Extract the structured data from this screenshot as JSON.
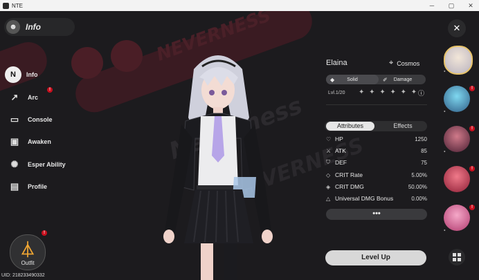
{
  "window": {
    "title": "NTE",
    "min": "─",
    "max": "▢",
    "close": "✕"
  },
  "header": {
    "title": "Info"
  },
  "nav": [
    {
      "label": "Info",
      "icon": "N"
    },
    {
      "label": "Arc",
      "icon": "↗"
    },
    {
      "label": "Console",
      "icon": "▭"
    },
    {
      "label": "Awaken",
      "icon": "▣"
    },
    {
      "label": "Esper Ability",
      "icon": "✺"
    },
    {
      "label": "Profile",
      "icon": "▤"
    }
  ],
  "badge": "!",
  "outfit": {
    "label": "Outfit"
  },
  "uid": "UID: 218233490332",
  "banner_text": [
    "NEVERNESS",
    "Neverness",
    "NEVERNESS"
  ],
  "character": {
    "name": "Elaina",
    "faction": "Cosmos",
    "attributes_tags": [
      "Solid",
      "Damage"
    ],
    "level": "Lvl.1/20",
    "stars": "✦ ✦ ✦ ✦ ✦ ✦"
  },
  "tabs": {
    "attributes": "Attributes",
    "effects": "Effects"
  },
  "stats": [
    {
      "label": "HP",
      "value": "1250",
      "icon": "♡"
    },
    {
      "label": "ATK",
      "value": "85",
      "icon": "⚔"
    },
    {
      "label": "DEF",
      "value": "75",
      "icon": "⛉"
    },
    {
      "label": "CRIT Rate",
      "value": "5.00%",
      "icon": "◇"
    },
    {
      "label": "CRIT DMG",
      "value": "50.00%",
      "icon": "◈"
    },
    {
      "label": "Universal DMG Bonus",
      "value": "0.00%",
      "icon": "△"
    }
  ],
  "more": "•••",
  "level_up": "Level Up",
  "close": "✕",
  "colors": {
    "accent_red": "#c8101e",
    "gold": "#e7c36a",
    "outfit": "#f2a733"
  }
}
